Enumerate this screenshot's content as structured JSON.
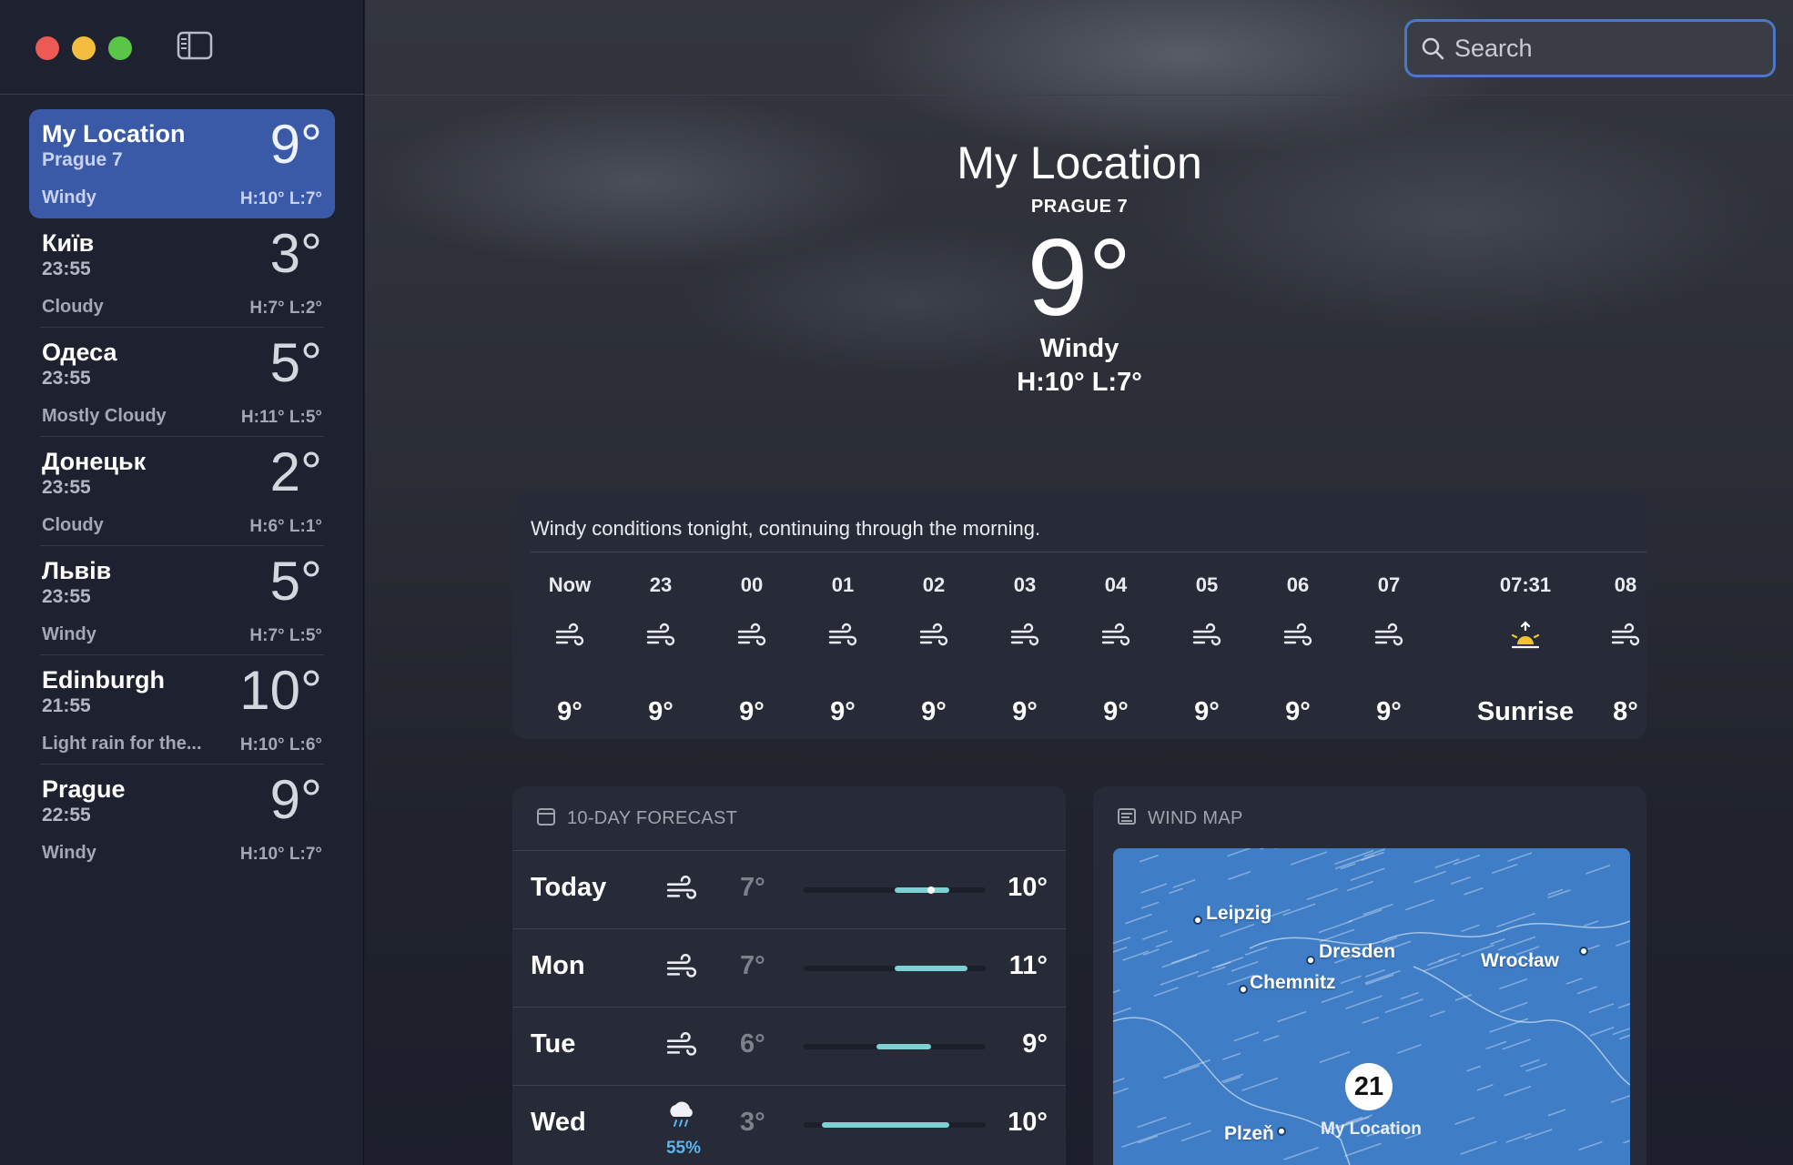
{
  "window": {
    "search_placeholder": "Search"
  },
  "sidebar": {
    "cities": [
      {
        "name": "My Location",
        "sub": "Prague 7",
        "temp": "9°",
        "condition": "Windy",
        "hl": "H:10°  L:7°",
        "selected": true
      },
      {
        "name": "Київ",
        "sub": "23:55",
        "temp": "3°",
        "condition": "Cloudy",
        "hl": "H:7°  L:2°"
      },
      {
        "name": "Одеса",
        "sub": "23:55",
        "temp": "5°",
        "condition": "Mostly Cloudy",
        "hl": "H:11°  L:5°"
      },
      {
        "name": "Донецьк",
        "sub": "23:55",
        "temp": "2°",
        "condition": "Cloudy",
        "hl": "H:6°  L:1°"
      },
      {
        "name": "Львів",
        "sub": "23:55",
        "temp": "5°",
        "condition": "Windy",
        "hl": "H:7°  L:5°"
      },
      {
        "name": "Edinburgh",
        "sub": "21:55",
        "temp": "10°",
        "condition": "Light rain for the...",
        "hl": "H:10°  L:6°"
      },
      {
        "name": "Prague",
        "sub": "22:55",
        "temp": "9°",
        "condition": "Windy",
        "hl": "H:10°  L:7°"
      }
    ]
  },
  "hero": {
    "location": "My Location",
    "sub": "PRAGUE 7",
    "temp": "9°",
    "condition": "Windy",
    "hl": "H:10°  L:7°"
  },
  "hourly": {
    "summary": "Windy conditions tonight, continuing through the morning.",
    "hours": [
      {
        "label": "Now",
        "icon": "wind-icon",
        "temp": "9°"
      },
      {
        "label": "23",
        "icon": "wind-icon",
        "temp": "9°"
      },
      {
        "label": "00",
        "icon": "wind-icon",
        "temp": "9°"
      },
      {
        "label": "01",
        "icon": "wind-icon",
        "temp": "9°"
      },
      {
        "label": "02",
        "icon": "wind-icon",
        "temp": "9°"
      },
      {
        "label": "03",
        "icon": "wind-icon",
        "temp": "9°"
      },
      {
        "label": "04",
        "icon": "wind-icon",
        "temp": "9°"
      },
      {
        "label": "05",
        "icon": "wind-icon",
        "temp": "9°"
      },
      {
        "label": "06",
        "icon": "wind-icon",
        "temp": "9°"
      },
      {
        "label": "07",
        "icon": "wind-icon",
        "temp": "9°"
      },
      {
        "label": "07:31",
        "icon": "sunrise-icon",
        "temp": "Sunrise"
      },
      {
        "label": "08",
        "icon": "wind-icon",
        "temp": "8°"
      }
    ]
  },
  "forecast": {
    "title": "10-DAY FORECAST",
    "range": [
      2,
      12
    ],
    "days": [
      {
        "day": "Today",
        "icon": "wind-icon",
        "pop": "",
        "lo": "7°",
        "hi": "10°",
        "lo_val": 7,
        "hi_val": 10,
        "current": 9
      },
      {
        "day": "Mon",
        "icon": "wind-icon",
        "pop": "",
        "lo": "7°",
        "hi": "11°",
        "lo_val": 7,
        "hi_val": 11
      },
      {
        "day": "Tue",
        "icon": "wind-icon",
        "pop": "",
        "lo": "6°",
        "hi": "9°",
        "lo_val": 6,
        "hi_val": 9
      },
      {
        "day": "Wed",
        "icon": "rain-cloud-icon",
        "pop": "55%",
        "lo": "3°",
        "hi": "10°",
        "lo_val": 3,
        "hi_val": 10
      }
    ]
  },
  "windmap": {
    "title": "WIND MAP",
    "badge": "21",
    "my_location_label": "My Location",
    "cities": [
      "Leipzig",
      "Dresden",
      "Wrocław",
      "Chemnitz",
      "Plzeň"
    ]
  },
  "colors": {
    "accent": "#3a5aa8",
    "bar_fill": "#7dd0d4",
    "map_water": "#3f7ec7"
  }
}
